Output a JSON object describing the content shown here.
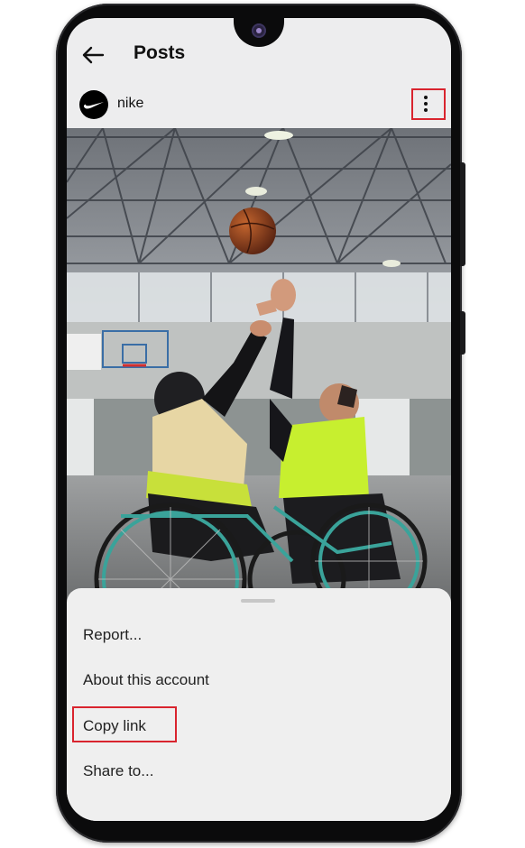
{
  "header": {
    "title": "Posts",
    "back_icon": "arrow-left-icon"
  },
  "post": {
    "username": "nike",
    "avatar_icon": "swoosh-logo-icon",
    "more_icon": "more-vertical-icon",
    "image_description_icon": "photo"
  },
  "sheet": {
    "items": [
      {
        "label": "Report..."
      },
      {
        "label": "About this account"
      },
      {
        "label": "Copy link"
      },
      {
        "label": "Share to..."
      }
    ]
  },
  "colors": {
    "highlight": "#d9242e",
    "screen_bg": "#ededee",
    "sheet_bg": "#efefef"
  }
}
